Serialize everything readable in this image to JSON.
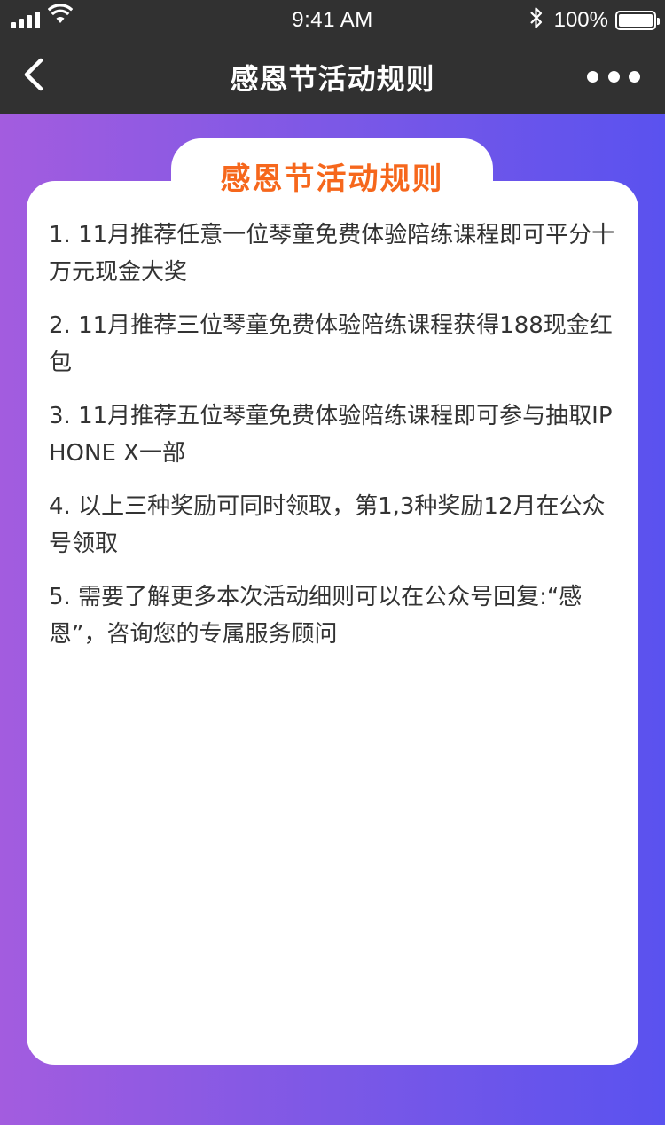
{
  "status_bar": {
    "time": "9:41 AM",
    "battery": "100%",
    "icons": [
      "signal-icon",
      "wifi-icon",
      "bluetooth-icon",
      "battery-icon"
    ]
  },
  "nav": {
    "title": "感恩节活动规则",
    "back_icon": "chevron-left-icon",
    "more_icon": "more-dots-icon"
  },
  "card": {
    "heading": "感恩节活动规则",
    "heading_color": "#f6671c",
    "rules": [
      "1. 11月推荐任意一位琴童免费体验陪练课程即可平分十万元现金大奖",
      "2. 11月推荐三位琴童免费体验陪练课程获得188现金红包",
      "3. 11月推荐五位琴童免费体验陪练课程即可参与抽取IPHONE X一部",
      "4. 以上三种奖励可同时领取，第1,3种奖励12月在公众号领取",
      "5. 需要了解更多本次活动细则可以在公众号回复:“感恩”，咨询您的专属服务顾问"
    ]
  },
  "colors": {
    "bar_bg": "#313131",
    "gradient_start": "#a35cdf",
    "gradient_end": "#5a52ef",
    "text": "#333333"
  }
}
